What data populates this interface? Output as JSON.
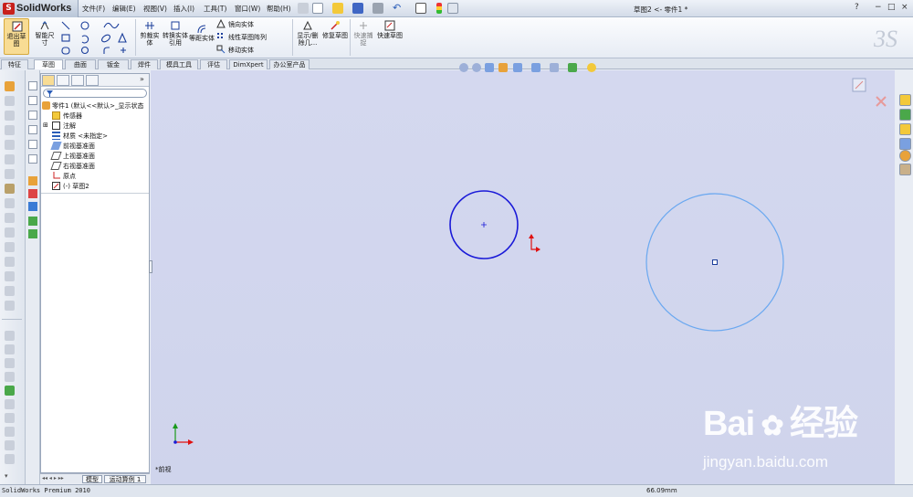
{
  "app": {
    "name": "SolidWorks",
    "status_text": "SolidWorks Premium 2010"
  },
  "menu": [
    "文件(F)",
    "编辑(E)",
    "视图(V)",
    "插入(I)",
    "工具(T)",
    "窗口(W)",
    "帮助(H)"
  ],
  "window_title": "草图2 <- 零件1 *",
  "window_controls": {
    "help": "?",
    "minimize": "−",
    "restore": "□",
    "close": "×"
  },
  "command_manager": {
    "exit_sketch": "退出草图",
    "smart_dimension": "智能尺寸",
    "trim_entities": "剪裁实体",
    "convert_entities": "转换实体引用",
    "offset_entities": "等距实体",
    "mirror_entities": "镜向实体",
    "linear_pattern": "线性草图阵列",
    "move_entities": "移动实体",
    "display_delete": "显示/删除几...",
    "repair_sketch": "修复草图",
    "quick_snaps": "快速捕捉",
    "rapid_sketch": "快速草图"
  },
  "tabs": [
    {
      "label": "特征",
      "active": false
    },
    {
      "label": "草图",
      "active": true
    },
    {
      "label": "曲面",
      "active": false
    },
    {
      "label": "钣金",
      "active": false
    },
    {
      "label": "焊件",
      "active": false
    },
    {
      "label": "模具工具",
      "active": false
    },
    {
      "label": "评估",
      "active": false
    },
    {
      "label": "DimXpert",
      "active": false
    },
    {
      "label": "办公室产品",
      "active": false
    }
  ],
  "feature_tree": {
    "root": "零件1  (默认<<默认>_显示状态",
    "items": [
      "传感器",
      "注解",
      "材质 <未指定>",
      "前视基准面",
      "上视基准面",
      "右视基准面",
      "原点",
      "(-) 草图2"
    ]
  },
  "bottom_tabs": [
    "模型",
    "运动算例 1"
  ],
  "view_name": "*前视",
  "status_measure": "66.09mm",
  "watermark": {
    "brand": "Bai",
    "suffix": "经验",
    "url": "jingyan.baidu.com"
  },
  "colors": {
    "graphics_bg": "#d0d5ed",
    "selected_circle": "#1a1ad8",
    "preview_circle": "#6aa8f0",
    "origin_red": "#e01010"
  }
}
